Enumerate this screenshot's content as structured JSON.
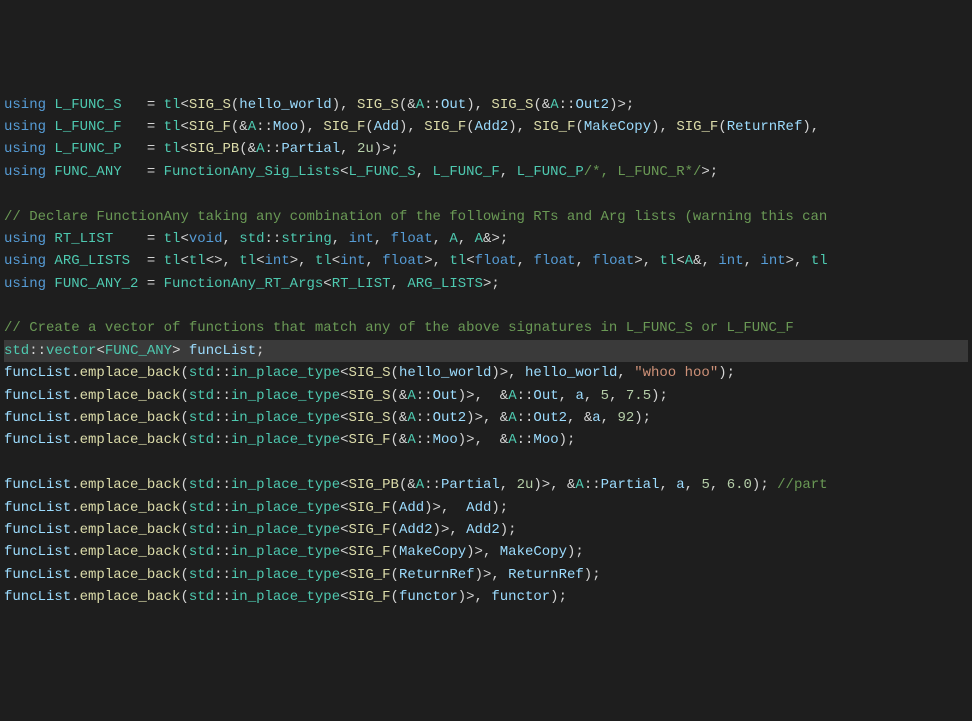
{
  "lines": [
    {
      "html": "<span class='kw'>using</span> <span class='type'>L_FUNC_S</span>   = <span class='type'>tl</span>&lt;<span class='fn'>SIG_S</span>(<span class='var'>hello_world</span>), <span class='fn'>SIG_S</span>(&amp;<span class='type'>A</span>::<span class='var'>Out</span>), <span class='fn'>SIG_S</span>(&amp;<span class='type'>A</span>::<span class='var'>Out2</span>)&gt;;"
    },
    {
      "html": "<span class='kw'>using</span> <span class='type'>L_FUNC_F</span>   = <span class='type'>tl</span>&lt;<span class='fn'>SIG_F</span>(&amp;<span class='type'>A</span>::<span class='var'>Moo</span>), <span class='fn'>SIG_F</span>(<span class='var'>Add</span>), <span class='fn'>SIG_F</span>(<span class='var'>Add2</span>), <span class='fn'>SIG_F</span>(<span class='var'>MakeCopy</span>), <span class='fn'>SIG_F</span>(<span class='var'>ReturnRef</span>),"
    },
    {
      "html": "<span class='kw'>using</span> <span class='type'>L_FUNC_P</span>   = <span class='type'>tl</span>&lt;<span class='fn'>SIG_PB</span>(&amp;<span class='type'>A</span>::<span class='var'>Partial</span>, <span class='num'>2u</span>)&gt;;"
    },
    {
      "html": "<span class='kw'>using</span> <span class='type'>FUNC_ANY</span>   = <span class='type'>FunctionAny_Sig_Lists</span>&lt;<span class='type'>L_FUNC_S</span>, <span class='type'>L_FUNC_F</span>, <span class='type'>L_FUNC_P</span><span class='comment'>/*, L_FUNC_R*/</span>&gt;;"
    },
    {
      "html": ""
    },
    {
      "html": "<span class='comment'>// Declare FunctionAny taking any combination of the following RTs and Arg lists (warning this can</span>"
    },
    {
      "html": "<span class='kw'>using</span> <span class='type'>RT_LIST</span>    = <span class='type'>tl</span>&lt;<span class='kw'>void</span>, <span class='type'>std</span>::<span class='type'>string</span>, <span class='kw'>int</span>, <span class='kw'>float</span>, <span class='type'>A</span>, <span class='type'>A</span>&amp;&gt;;"
    },
    {
      "html": "<span class='kw'>using</span> <span class='type'>ARG_LISTS</span>  = <span class='type'>tl</span>&lt;<span class='type'>tl</span>&lt;&gt;, <span class='type'>tl</span>&lt;<span class='kw'>int</span>&gt;, <span class='type'>tl</span>&lt;<span class='kw'>int</span>, <span class='kw'>float</span>&gt;, <span class='type'>tl</span>&lt;<span class='kw'>float</span>, <span class='kw'>float</span>, <span class='kw'>float</span>&gt;, <span class='type'>tl</span>&lt;<span class='type'>A</span>&amp;, <span class='kw'>int</span>, <span class='kw'>int</span>&gt;, <span class='type'>tl</span>"
    },
    {
      "html": "<span class='kw'>using</span> <span class='type'>FUNC_ANY_2</span> = <span class='type'>FunctionAny_RT_Args</span>&lt;<span class='type'>RT_LIST</span>, <span class='type'>ARG_LISTS</span>&gt;;"
    },
    {
      "html": ""
    },
    {
      "html": "<span class='comment'>// Create a vector of functions that match any of the above signatures in L_FUNC_S or L_FUNC_F</span>"
    },
    {
      "html": "<span class='type'>std</span>::<span class='type'>vector</span>&lt;<span class='type'>FUNC_ANY</span>&gt; <span class='var'>funcList</span>;",
      "highlight": true
    },
    {
      "html": "<span class='var'>funcList</span>.<span class='fn'>emplace_back</span>(<span class='type'>std</span>::<span class='type'>in_place_type</span>&lt;<span class='fn'>SIG_S</span>(<span class='var'>hello_world</span>)&gt;, <span class='var'>hello_world</span>, <span class='str'>\"whoo hoo\"</span>);"
    },
    {
      "html": "<span class='var'>funcList</span>.<span class='fn'>emplace_back</span>(<span class='type'>std</span>::<span class='type'>in_place_type</span>&lt;<span class='fn'>SIG_S</span>(&amp;<span class='type'>A</span>::<span class='var'>Out</span>)&gt;,  &amp;<span class='type'>A</span>::<span class='var'>Out</span>, <span class='var'>a</span>, <span class='num'>5</span>, <span class='num'>7.5</span>);"
    },
    {
      "html": "<span class='var'>funcList</span>.<span class='fn'>emplace_back</span>(<span class='type'>std</span>::<span class='type'>in_place_type</span>&lt;<span class='fn'>SIG_S</span>(&amp;<span class='type'>A</span>::<span class='var'>Out2</span>)&gt;, &amp;<span class='type'>A</span>::<span class='var'>Out2</span>, &amp;<span class='var'>a</span>, <span class='num'>92</span>);"
    },
    {
      "html": "<span class='var'>funcList</span>.<span class='fn'>emplace_back</span>(<span class='type'>std</span>::<span class='type'>in_place_type</span>&lt;<span class='fn'>SIG_F</span>(&amp;<span class='type'>A</span>::<span class='var'>Moo</span>)&gt;,  &amp;<span class='type'>A</span>::<span class='var'>Moo</span>);"
    },
    {
      "html": ""
    },
    {
      "html": "<span class='var'>funcList</span>.<span class='fn'>emplace_back</span>(<span class='type'>std</span>::<span class='type'>in_place_type</span>&lt;<span class='fn'>SIG_PB</span>(&amp;<span class='type'>A</span>::<span class='var'>Partial</span>, <span class='num'>2u</span>)&gt;, &amp;<span class='type'>A</span>::<span class='var'>Partial</span>, <span class='var'>a</span>, <span class='num'>5</span>, <span class='num'>6.0</span>); <span class='comment'>//part</span>"
    },
    {
      "html": "<span class='var'>funcList</span>.<span class='fn'>emplace_back</span>(<span class='type'>std</span>::<span class='type'>in_place_type</span>&lt;<span class='fn'>SIG_F</span>(<span class='var'>Add</span>)&gt;,  <span class='var'>Add</span>);"
    },
    {
      "html": "<span class='var'>funcList</span>.<span class='fn'>emplace_back</span>(<span class='type'>std</span>::<span class='type'>in_place_type</span>&lt;<span class='fn'>SIG_F</span>(<span class='var'>Add2</span>)&gt;, <span class='var'>Add2</span>);"
    },
    {
      "html": "<span class='var'>funcList</span>.<span class='fn'>emplace_back</span>(<span class='type'>std</span>::<span class='type'>in_place_type</span>&lt;<span class='fn'>SIG_F</span>(<span class='var'>MakeCopy</span>)&gt;, <span class='var'>MakeCopy</span>);"
    },
    {
      "html": "<span class='var'>funcList</span>.<span class='fn'>emplace_back</span>(<span class='type'>std</span>::<span class='type'>in_place_type</span>&lt;<span class='fn'>SIG_F</span>(<span class='var'>ReturnRef</span>)&gt;, <span class='var'>ReturnRef</span>);"
    },
    {
      "html": "<span class='var'>funcList</span>.<span class='fn'>emplace_back</span>(<span class='type'>std</span>::<span class='type'>in_place_type</span>&lt;<span class='fn'>SIG_F</span>(<span class='var'>functor</span>)&gt;, <span class='var'>functor</span>);"
    }
  ]
}
